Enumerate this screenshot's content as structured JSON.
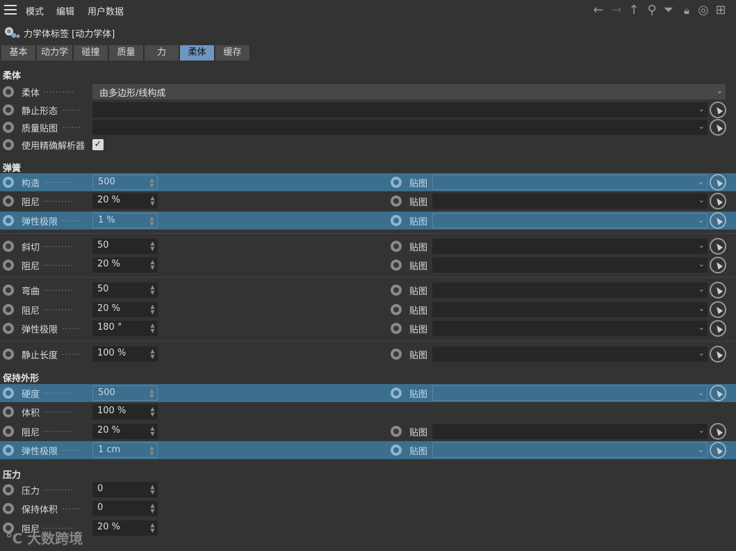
{
  "menu": {
    "items": [
      "模式",
      "编辑",
      "用户数据"
    ]
  },
  "tag": {
    "title": "力学体标签 [动力学体]"
  },
  "tabs": [
    "基本",
    "动力学",
    "碰撞",
    "质量",
    "力",
    "柔体",
    "缓存"
  ],
  "active_tab": "柔体",
  "sections": {
    "soft": "柔体",
    "spring": "弹簧",
    "shape": "保持外形",
    "pressure": "压力"
  },
  "soft": {
    "mode_label": "柔体",
    "mode_value": "由多边形/线构成",
    "rest_label": "静止形态",
    "mass_label": "质量贴图",
    "solver_label": "使用精确解析器",
    "solver_checked": "✓"
  },
  "map_label": "贴图",
  "spring": {
    "rows": [
      {
        "label": "构造",
        "value": "500"
      },
      {
        "label": "阻尼",
        "value": "20 %"
      },
      {
        "label": "弹性极限",
        "value": "1 %"
      },
      {
        "label": "斜切",
        "value": "50"
      },
      {
        "label": "阻尼",
        "value": "20 %"
      },
      {
        "label": "弯曲",
        "value": "50"
      },
      {
        "label": "阻尼",
        "value": "20 %"
      },
      {
        "label": "弹性极限",
        "value": "180 °"
      },
      {
        "label": "静止长度",
        "value": "100 %"
      }
    ]
  },
  "shape": {
    "rows": [
      {
        "label": "硬度",
        "value": "500"
      },
      {
        "label": "体积",
        "value": "100 %"
      },
      {
        "label": "阻尼",
        "value": "20 %"
      },
      {
        "label": "弹性极限",
        "value": "1 cm"
      }
    ]
  },
  "pressure": {
    "rows": [
      {
        "label": "压力",
        "value": "0"
      },
      {
        "label": "保持体积",
        "value": "0"
      },
      {
        "label": "阻尼",
        "value": "20 %"
      }
    ]
  },
  "watermark": "大数跨境",
  "colors": {
    "background": "#333333",
    "highlight": "#3c6e8e",
    "active_tab": "#6d96c2",
    "field": "#262626"
  }
}
